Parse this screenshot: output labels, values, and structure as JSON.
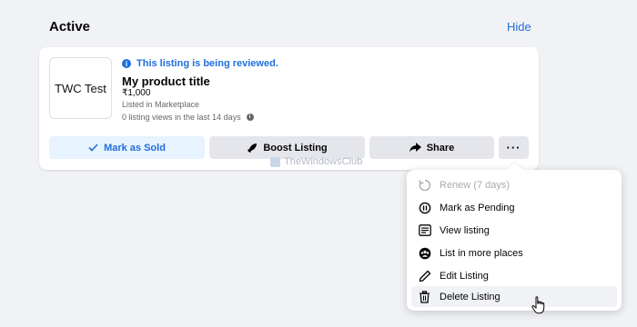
{
  "section": {
    "title": "Active",
    "hide_label": "Hide"
  },
  "listing": {
    "thumbnail_text": "TWC Test",
    "status_text": "This listing is being reviewed.",
    "title": "My product title",
    "price": "₹1,000",
    "listed_in": "Listed in Marketplace",
    "views": "0 listing views in the last 14 days"
  },
  "actions": {
    "mark_sold": "Mark as Sold",
    "boost": "Boost Listing",
    "share": "Share",
    "more": "···"
  },
  "watermark": {
    "text": "TheWindowsClub"
  },
  "menu": {
    "items": [
      {
        "label": "Renew (7 days)",
        "icon": "renew-icon",
        "disabled": true
      },
      {
        "label": "Mark as Pending",
        "icon": "pause-icon",
        "disabled": false
      },
      {
        "label": "View listing",
        "icon": "document-icon",
        "disabled": false
      },
      {
        "label": "List in more places",
        "icon": "groups-icon",
        "disabled": false
      },
      {
        "label": "Edit Listing",
        "icon": "pencil-icon",
        "disabled": false
      },
      {
        "label": "Delete Listing",
        "icon": "trash-icon",
        "disabled": false,
        "hovered": true
      }
    ]
  },
  "colors": {
    "accent": "#216fdb",
    "accent_bg": "#e7f3ff",
    "button_bg": "#e4e6eb",
    "page_bg": "#f0f2f5",
    "disabled_text": "#a8abaf"
  }
}
